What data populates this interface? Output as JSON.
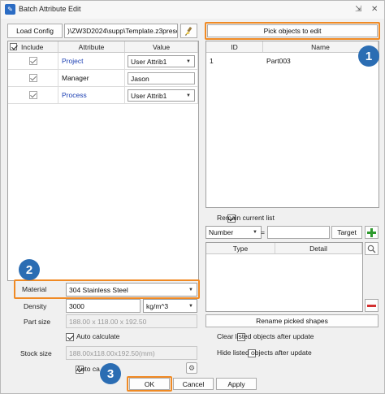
{
  "window": {
    "title": "Batch Attribute Edit",
    "pin_glyph": "⇲",
    "close_glyph": "✕"
  },
  "config": {
    "load_label": "Load Config",
    "path_value": ")\\ZW3D2024\\supp\\Template.z3preset",
    "brush_icon": "paintbrush-icon"
  },
  "attr_table": {
    "headers": {
      "include": "Include",
      "attribute": "Attribute",
      "value": "Value"
    },
    "rows": [
      {
        "include": true,
        "attribute": "Project",
        "value": "User Attrib1",
        "value_is_combo": true,
        "color": "#1b3fb3"
      },
      {
        "include": true,
        "attribute": "Manager",
        "value": "Jason",
        "value_is_combo": false,
        "color": "#222222"
      },
      {
        "include": true,
        "attribute": "Process",
        "value": "User Attrib1",
        "value_is_combo": true,
        "color": "#1b3fb3"
      }
    ]
  },
  "material": {
    "label": "Material",
    "value": "304 Stainless Steel"
  },
  "density": {
    "label": "Density",
    "value": "3000",
    "unit": "kg/m^3"
  },
  "part_size": {
    "label": "Part size",
    "value": "188.00 x 118.00 x 192.50"
  },
  "auto_calc_1": {
    "label": "Auto calculate",
    "checked": true
  },
  "stock_size": {
    "label": "Stock size",
    "value": "188.00x118.00x192.50(mm)"
  },
  "auto_calc_2": {
    "label": "Auto ca",
    "checked": true
  },
  "pick": {
    "label": "Pick objects to edit"
  },
  "objects_table": {
    "headers": {
      "id": "ID",
      "name": "Name"
    },
    "rows": [
      {
        "id": "1",
        "name": "Part003"
      }
    ]
  },
  "remain": {
    "label": "Remain current list",
    "checked": true
  },
  "filter": {
    "field": "Number",
    "operator": "=",
    "value": "",
    "target_label": "Target"
  },
  "type_table": {
    "headers": {
      "type": "Type",
      "detail": "Detail"
    }
  },
  "rename_label": "Rename picked shapes",
  "clear_option": {
    "label": "Clear listed objects after update",
    "checked": false
  },
  "hide_option": {
    "label": "Hide listed objects after update",
    "checked": false
  },
  "buttons": {
    "ok": "OK",
    "cancel": "Cancel",
    "apply": "Apply"
  },
  "badges": {
    "b1": "1",
    "b2": "2",
    "b3": "3"
  },
  "colors": {
    "highlight": "#f08a24",
    "badge": "#2b6db3",
    "add": "#2e9a2e",
    "remove": "#d23030"
  }
}
